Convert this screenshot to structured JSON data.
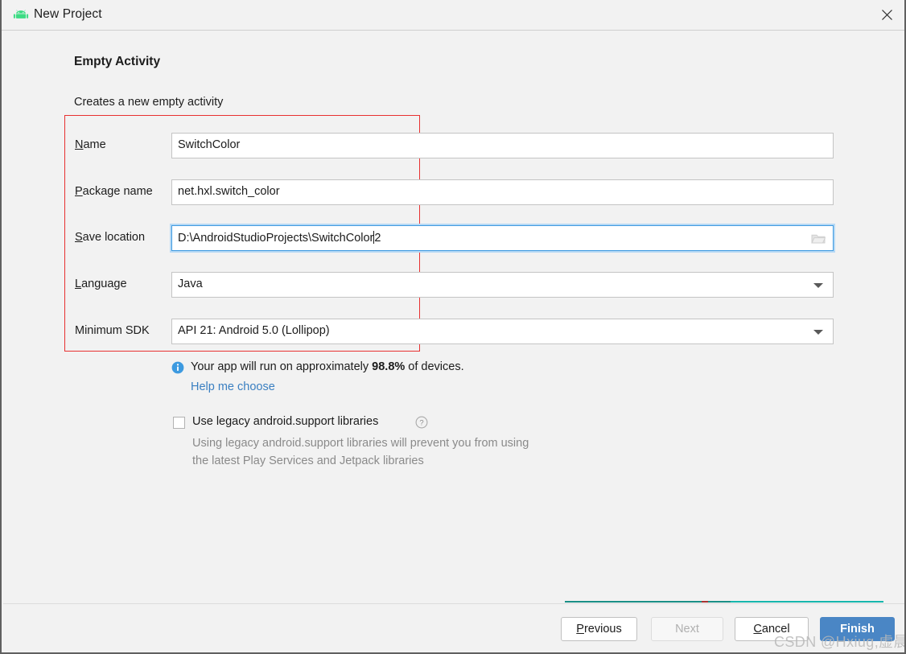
{
  "window": {
    "title": "New Project",
    "app_icon": "android-robot-icon",
    "close_label": "✕"
  },
  "page": {
    "heading": "Empty Activity",
    "subheading": "Creates a new empty activity"
  },
  "form": {
    "rows": [
      {
        "label_prefix": "",
        "label_mnemonic": "N",
        "label_suffix": "ame",
        "value": "SwitchColor",
        "type": "text",
        "name": "name"
      },
      {
        "label_prefix": "",
        "label_mnemonic": "P",
        "label_suffix": "ackage name",
        "value": "net.hxl.switch_color",
        "type": "text",
        "name": "package-name"
      },
      {
        "label_prefix": "",
        "label_mnemonic": "S",
        "label_suffix": "ave location",
        "value": "D:\\AndroidStudioProjects\\SwitchColor",
        "value_after_caret": "2",
        "type": "path",
        "name": "save-location"
      },
      {
        "label_prefix": "",
        "label_mnemonic": "L",
        "label_suffix": "anguage",
        "value": "Java",
        "type": "combo",
        "name": "language"
      },
      {
        "label_prefix": "Minimum SDK",
        "label_mnemonic": "",
        "label_suffix": "",
        "value": "API 21: Android 5.0 (Lollipop)",
        "type": "combo",
        "name": "minimum-sdk"
      }
    ]
  },
  "info": {
    "icon": "info-circle-icon",
    "text_before": "Your app will run on approximately ",
    "percent": "98.8%",
    "text_after": " of devices.",
    "help_link": "Help me choose"
  },
  "legacy": {
    "checkbox_checked": false,
    "checkbox_label": "Use legacy android.support libraries",
    "help_icon": "question-mark-icon",
    "description_line1": "Using legacy android.support libraries will prevent you from using",
    "description_line2": "the latest Play Services and Jetpack libraries"
  },
  "footer": {
    "buttons": [
      {
        "prefix": "",
        "mnemonic": "P",
        "suffix": "revious",
        "state": "enabled",
        "name": "previous-button"
      },
      {
        "prefix": "Next",
        "mnemonic": "",
        "suffix": "",
        "state": "disabled",
        "name": "next-button"
      },
      {
        "prefix": "",
        "mnemonic": "C",
        "suffix": "ancel",
        "state": "enabled",
        "name": "cancel-button"
      },
      {
        "prefix": "",
        "mnemonic": "F",
        "suffix": "inish",
        "state": "primary",
        "name": "finish-button"
      }
    ]
  },
  "watermark": {
    "text": "CSDN @Hxiug,虚晨"
  },
  "colors": {
    "accent": "#4a86c5",
    "annotation": "#e83131",
    "link": "#3a7fc1",
    "android_green": "#3ddc84",
    "muted_text": "#8a8a8a"
  }
}
